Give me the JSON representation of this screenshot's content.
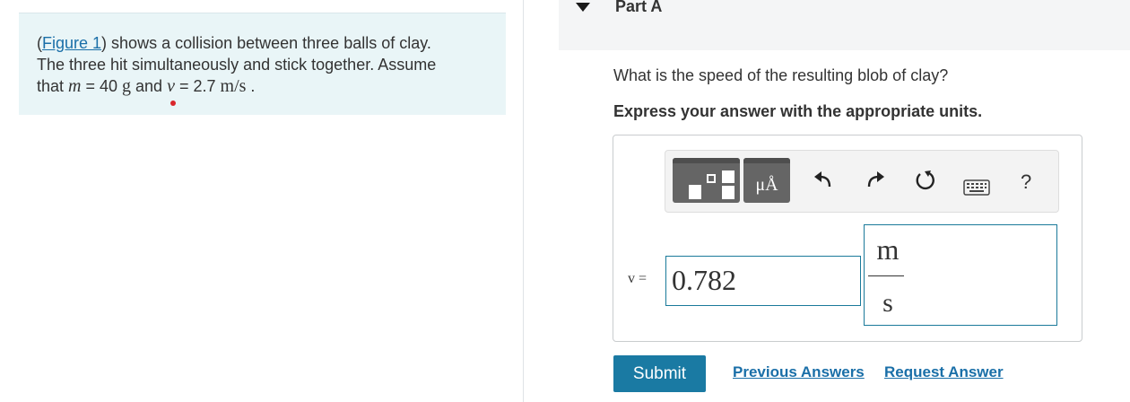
{
  "problem": {
    "link_text": "Figure 1",
    "open_paren": "(",
    "line1_rest": ") shows a collision between three balls of clay.",
    "line2": "The three hit simultaneously and stick together. Assume",
    "line3_prefix": "that ",
    "m_var": "m",
    "m_eq": " = 40 ",
    "m_unit": "g",
    "and": " and ",
    "v_var": "v",
    "v_eq": " = 2.7 ",
    "v_unit": "m/s",
    "period": " ."
  },
  "part": {
    "title": "Part A",
    "question": "What is the speed of the resulting blob of clay?",
    "instruction": "Express your answer with the appropriate units."
  },
  "toolbar": {
    "unit_glyph": "μÅ",
    "help": "?",
    "icons": [
      "templates-icon",
      "units-icon",
      "undo-icon",
      "redo-icon",
      "reset-icon",
      "keyboard-icon",
      "help-icon"
    ]
  },
  "answer": {
    "variable": "v =",
    "value": "0.782",
    "unit_numerator": "m",
    "unit_denominator": "s"
  },
  "actions": {
    "submit": "Submit",
    "previous_answers": "Previous Answers",
    "request_answer": "Request Answer"
  },
  "colors": {
    "problem_bg": "#e9f5f7",
    "accent": "#1a7aa3",
    "link": "#1a6fa8"
  }
}
